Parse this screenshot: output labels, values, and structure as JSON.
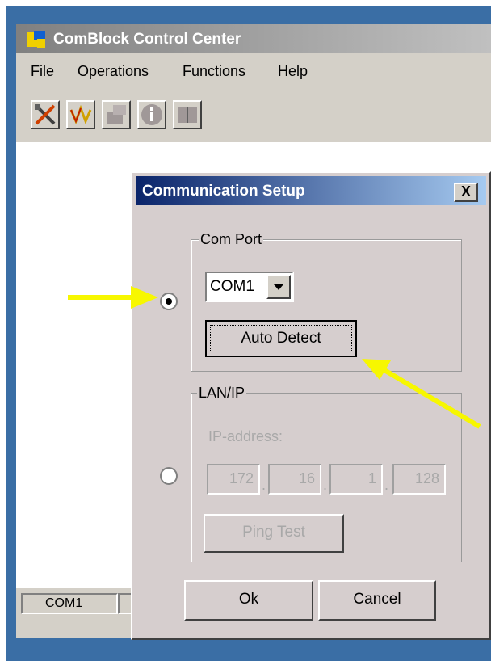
{
  "main_window": {
    "title": "ComBlock Control Center",
    "menu": [
      {
        "label": "File"
      },
      {
        "label": "Operations"
      },
      {
        "label": "Functions"
      },
      {
        "label": "Help"
      }
    ],
    "toolbar_icons": [
      "tools-icon",
      "signal-icon",
      "module-icon",
      "info-icon",
      "book-icon"
    ],
    "status": {
      "port": "COM1"
    }
  },
  "dialog": {
    "title": "Communication Setup",
    "close_label": "X",
    "com_port": {
      "legend": "Com Port",
      "selected_port": "COM1",
      "auto_detect_label": "Auto Detect"
    },
    "lan_ip": {
      "legend": "LAN/IP",
      "ip_label": "IP-address:",
      "octets": [
        "172",
        "16",
        "1",
        "128"
      ],
      "ping_label": "Ping Test"
    },
    "ok_label": "Ok",
    "cancel_label": "Cancel"
  },
  "colors": {
    "annotation_arrow": "#f7f700",
    "desktop": "#3a6ea5",
    "dialog_title": "#0a246a"
  }
}
